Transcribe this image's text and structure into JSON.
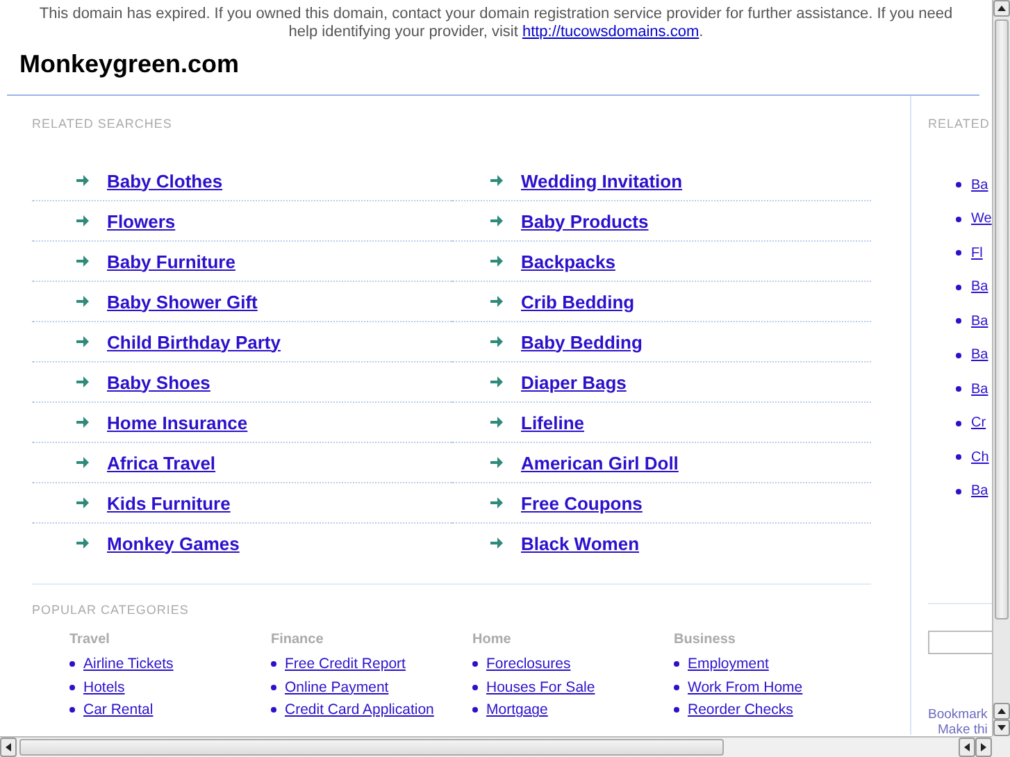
{
  "notice": {
    "text": "This domain has expired. If you owned this domain, contact your domain registration service provider for further assistance. If you need help identifying your provider, visit",
    "link": "http://tucowsdomains.com",
    "end": "."
  },
  "site_title": "Monkeygreen.com",
  "related_searches": {
    "heading": "RELATED SEARCHES",
    "items": [
      "Baby Clothes",
      "Wedding Invitation",
      "Flowers",
      "Baby Products",
      "Baby Furniture",
      "Backpacks",
      "Baby Shower Gift",
      "Crib Bedding",
      "Child Birthday Party",
      "Baby Bedding",
      "Baby Shoes",
      "Diaper Bags",
      "Home Insurance",
      "Lifeline",
      "Africa Travel",
      "American Girl Doll",
      "Kids Furniture",
      "Free Coupons",
      "Monkey Games",
      "Black Women"
    ]
  },
  "popular_categories": {
    "heading": "POPULAR CATEGORIES",
    "groups": [
      {
        "title": "Travel",
        "links": [
          "Airline Tickets",
          "Hotels",
          "Car Rental"
        ]
      },
      {
        "title": "Finance",
        "links": [
          "Free Credit Report",
          "Online Payment",
          "Credit Card Application"
        ]
      },
      {
        "title": "Home",
        "links": [
          "Foreclosures",
          "Houses For Sale",
          "Mortgage"
        ]
      },
      {
        "title": "Business",
        "links": [
          "Employment",
          "Work From Home",
          "Reorder Checks"
        ]
      }
    ]
  },
  "sidebar": {
    "heading": "RELATED",
    "items": [
      "Ba",
      "We",
      "Fl",
      "Ba",
      "Ba",
      "Ba",
      "Ba",
      "Cr",
      "Ch",
      "Ba"
    ],
    "bookmark": "Bookmark",
    "make": "Make thi"
  }
}
